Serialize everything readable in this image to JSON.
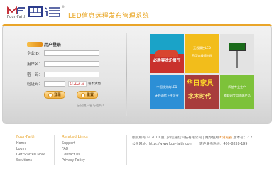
{
  "header": {
    "logo_sub": "Four-Faith",
    "logo_cn": "四信",
    "logo_reg": "®",
    "system_title": "LED信息远程发布管理系统"
  },
  "login": {
    "title": "用户登录",
    "fields": {
      "enterprise_label": "企业ID：",
      "enterprise_value": "",
      "username_label": "用户名：",
      "username_value": "",
      "password_label": "密　码：",
      "password_value": "",
      "captcha_label": "验证码：",
      "captcha_value": "",
      "captcha_image_text": "GXZE",
      "refresh_label": "看不清楚"
    },
    "login_button": "登录",
    "reset_button": "重置",
    "forgot_link": "忘记用户名与密码?"
  },
  "tiles": {
    "t1_sign": "必胜客欢乐餐厅",
    "t2_text_a": "无线操控LED",
    "t2_text_b": "不用连线随时改",
    "t4_text_a": "中国领先的LED",
    "t4_text_b": "无线通信上市企业",
    "t5_big": "华日家具",
    "t5_big2": "水木时代",
    "t6_text_a": "四信专业生产",
    "t6_text_b": "物联网专用终端产品"
  },
  "footer": {
    "col1": {
      "heading": "Four-Faith",
      "links": [
        "Home",
        "Login",
        "Get Started Now",
        "Solutions"
      ]
    },
    "col2": {
      "heading": "Related Links",
      "links": [
        "Support",
        "FAQ",
        "Contact us",
        "Privacy Policy"
      ]
    },
    "copyright_a": "版权所有 © 2010 厦门四信通信科技有限公司  |  推荐使用",
    "copyright_browser": "IE浏览器",
    "copyright_version_label": "  版本号：",
    "copyright_version": "2.2",
    "website_line": "公司网址：http://www.four-faith.com",
    "hotline": "客户服务热线：400-8838-199"
  }
}
